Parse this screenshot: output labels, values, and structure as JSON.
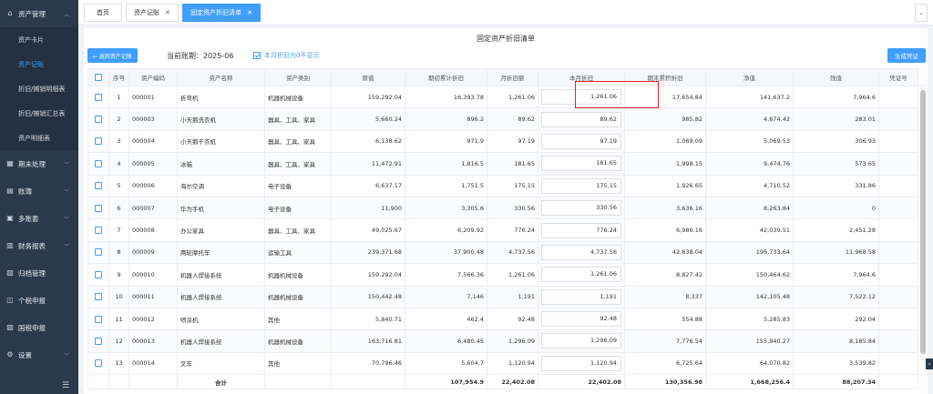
{
  "sidebar": {
    "groups": [
      {
        "label": "资产管理",
        "icon": "home-icon",
        "expanded": true,
        "items": [
          {
            "label": "资产卡片",
            "active": false
          },
          {
            "label": "资产记账",
            "active": true
          },
          {
            "label": "折旧/摊销明细表",
            "active": false
          },
          {
            "label": "折旧/摊销汇总表",
            "active": false
          },
          {
            "label": "资产明细表",
            "active": false
          }
        ]
      },
      {
        "label": "期末处理",
        "icon": "calendar-icon"
      },
      {
        "label": "账簿",
        "icon": "book-icon"
      },
      {
        "label": "多账套",
        "icon": "grid-icon"
      },
      {
        "label": "财务报表",
        "icon": "chart-icon"
      },
      {
        "label": "归档管理",
        "icon": "archive-icon"
      },
      {
        "label": "个税申报",
        "icon": "tax-icon"
      },
      {
        "label": "国税申报",
        "icon": "declare-icon"
      },
      {
        "label": "设置",
        "icon": "gear-icon"
      }
    ]
  },
  "tabs": [
    {
      "label": "首页",
      "closable": false
    },
    {
      "label": "资产记账",
      "closable": true
    },
    {
      "label": "固定资产折旧清单",
      "closable": true,
      "active": true
    }
  ],
  "page": {
    "title": "固定资产折旧清单",
    "back_button": "← 返回资产记账",
    "period": "当前账期：2025-06",
    "hide_zero_label": "本月折旧为0不显示",
    "hide_zero_checked": true,
    "generate_button": "生成凭证"
  },
  "table": {
    "headers": [
      "序号",
      "资产编码",
      "资产名称",
      "资产类别",
      "原值",
      "期初累计折旧",
      "月折旧额",
      "本月折旧",
      "期末累积折旧",
      "净值",
      "残值",
      "凭证号"
    ],
    "rows": [
      {
        "no": "1",
        "code": "000001",
        "name": "折弯机",
        "category": "机器机械设备",
        "original": "159,292.04",
        "opening_acc": "16,393.78",
        "monthly": "1,261.06",
        "current": "1,261.06",
        "closing_acc": "17,654.84",
        "net": "141,637.2",
        "residual": "7,964.6",
        "voucher": ""
      },
      {
        "no": "2",
        "code": "000003",
        "name": "小天鹅洗衣机",
        "category": "器具、工具、家具",
        "original": "5,660.24",
        "opening_acc": "896.2",
        "monthly": "89.62",
        "current": "89.62",
        "closing_acc": "985.82",
        "net": "4,674.42",
        "residual": "283.01",
        "voucher": ""
      },
      {
        "no": "3",
        "code": "000004",
        "name": "小天鹅干衣机",
        "category": "器具、工具、家具",
        "original": "6,138.62",
        "opening_acc": "971.9",
        "monthly": "97.19",
        "current": "97.19",
        "closing_acc": "1,069.09",
        "net": "5,069.53",
        "residual": "306.93",
        "voucher": ""
      },
      {
        "no": "4",
        "code": "000005",
        "name": "冰箱",
        "category": "器具、工具、家具",
        "original": "11,472.91",
        "opening_acc": "1,816.5",
        "monthly": "181.65",
        "current": "181.65",
        "closing_acc": "1,998.15",
        "net": "9,474.76",
        "residual": "573.65",
        "voucher": ""
      },
      {
        "no": "5",
        "code": "000006",
        "name": "海尔空调",
        "category": "电子设备",
        "original": "6,637.17",
        "opening_acc": "1,751.5",
        "monthly": "175.15",
        "current": "175.15",
        "closing_acc": "1,926.65",
        "net": "4,710.52",
        "residual": "331.86",
        "voucher": ""
      },
      {
        "no": "6",
        "code": "000007",
        "name": "华为手机",
        "category": "电子设备",
        "original": "11,900",
        "opening_acc": "3,305.6",
        "monthly": "330.56",
        "current": "330.56",
        "closing_acc": "3,636.16",
        "net": "8,263.84",
        "residual": "0",
        "voucher": ""
      },
      {
        "no": "7",
        "code": "000008",
        "name": "办公家具",
        "category": "器具、工具、家具",
        "original": "49,025.67",
        "opening_acc": "6,209.92",
        "monthly": "776.24",
        "current": "776.24",
        "closing_acc": "6,986.16",
        "net": "42,039.51",
        "residual": "2,451.28",
        "voucher": ""
      },
      {
        "no": "8",
        "code": "000009",
        "name": "两轮摩托车",
        "category": "运输工具",
        "original": "239,371.68",
        "opening_acc": "37,900.48",
        "monthly": "4,737.56",
        "current": "4,737.56",
        "closing_acc": "42,638.04",
        "net": "196,733.64",
        "residual": "11,968.58",
        "voucher": ""
      },
      {
        "no": "9",
        "code": "000010",
        "name": "机器人焊接系统",
        "category": "机器机械设备",
        "original": "159,292.04",
        "opening_acc": "7,566.36",
        "monthly": "1,261.06",
        "current": "1,261.06",
        "closing_acc": "8,827.42",
        "net": "150,464.62",
        "residual": "7,964.6",
        "voucher": ""
      },
      {
        "no": "10",
        "code": "000011",
        "name": "机器人焊接系统",
        "category": "机器机械设备",
        "original": "150,442.48",
        "opening_acc": "7,146",
        "monthly": "1,191",
        "current": "1,191",
        "closing_acc": "8,337",
        "net": "142,105.48",
        "residual": "7,522.12",
        "voucher": ""
      },
      {
        "no": "11",
        "code": "000012",
        "name": "喷涂机",
        "category": "其他",
        "original": "5,840.71",
        "opening_acc": "462.4",
        "monthly": "92.48",
        "current": "92.48",
        "closing_acc": "554.88",
        "net": "5,285.83",
        "residual": "292.04",
        "voucher": ""
      },
      {
        "no": "12",
        "code": "000013",
        "name": "机器人焊接系统",
        "category": "机器机械设备",
        "original": "163,716.81",
        "opening_acc": "6,480.45",
        "monthly": "1,296.09",
        "current": "1,296.09",
        "closing_acc": "7,776.54",
        "net": "155,940.27",
        "residual": "8,185.84",
        "voucher": ""
      },
      {
        "no": "13",
        "code": "000014",
        "name": "叉车",
        "category": "其他",
        "original": "70,796.46",
        "opening_acc": "5,604.7",
        "monthly": "1,120.94",
        "current": "1,120.94",
        "closing_acc": "6,725.64",
        "net": "64,070.82",
        "residual": "3,539.82",
        "voucher": ""
      }
    ],
    "footer": {
      "label": "合计",
      "opening_acc": "107,954.9",
      "monthly": "22,402.08",
      "current": "22,402.08",
      "closing_acc": "130,356.98",
      "net": "1,668,256.4",
      "residual": "88,207.34"
    }
  },
  "colors": {
    "accent": "#409eff",
    "sidebar": "#2b3a4a",
    "highlight": "#e02020"
  }
}
